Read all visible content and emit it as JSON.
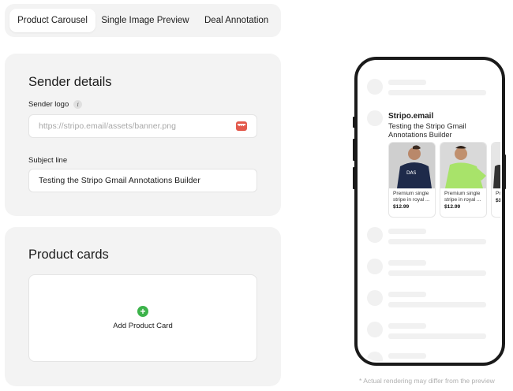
{
  "tabs": [
    {
      "label": "Product Carousel",
      "active": true
    },
    {
      "label": "Single Image Preview",
      "active": false
    },
    {
      "label": "Deal Annotation",
      "active": false
    }
  ],
  "sender": {
    "title": "Sender details",
    "logo_label": "Sender logo",
    "logo_placeholder": "https://stripo.email/assets/banner.png",
    "subject_label": "Subject line",
    "subject_value": "Testing the Stripo Gmail Annotations Builder"
  },
  "cards": {
    "title": "Product cards",
    "add_label": "Add Product Card"
  },
  "preview": {
    "sender_name": "Stripo.email",
    "subject": "Testing the Stripo Gmail Annotations Builder",
    "products": [
      {
        "desc": "Premium single stripe in royal ...",
        "price": "$12.99",
        "shirt_color": "#1e2a4a"
      },
      {
        "desc": "Premium single stripe in royal ...",
        "price": "$12.99",
        "shirt_color": "#a8e36a"
      },
      {
        "desc": "Pr st",
        "price": "$1",
        "shirt_color": "#333333"
      }
    ],
    "disclaimer": "* Actual rendering may differ from the preview"
  },
  "colors": {
    "panel_bg": "#f3f3f3",
    "accent_green": "#3cb34a",
    "upload_red": "#e35a4d",
    "phone_frame": "#1a1a1a"
  }
}
